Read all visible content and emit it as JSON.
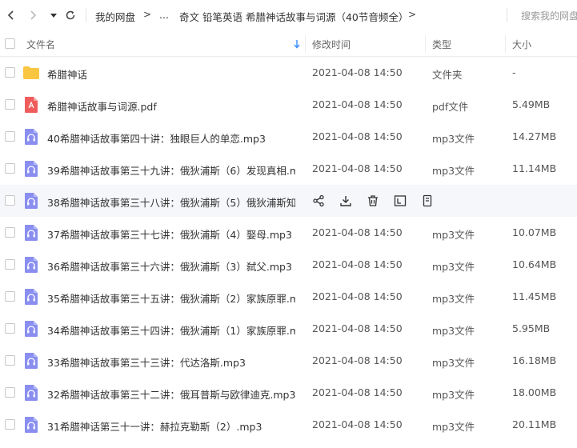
{
  "toolbar": {
    "breadcrumb": [
      "我的网盘",
      "...",
      "奇文 铅笔英语 希腊神话故事与词源（40节音频全）"
    ],
    "separator": ">",
    "search_placeholder": "搜索我的网盘"
  },
  "columns": {
    "name": "文件名",
    "modified": "修改时间",
    "type": "类型",
    "size": "大小"
  },
  "files": [
    {
      "name": "希腊神话",
      "date": "2021-04-08 14:50",
      "type": "文件夹",
      "size": "-",
      "icon": "folder-icon"
    },
    {
      "name": "希腊神话故事与词源.pdf",
      "date": "2021-04-08 14:50",
      "type": "pdf文件",
      "size": "5.49MB",
      "icon": "pdf-file-icon"
    },
    {
      "name": "40希腊神话故事第四十讲：独眼巨人的单恋.mp3",
      "date": "2021-04-08 14:50",
      "type": "mp3文件",
      "size": "14.27MB",
      "icon": "audio-file-icon"
    },
    {
      "name": "39希腊神话故事第三十九讲：俄狄浦斯（6）发现真相.m...",
      "date": "2021-04-08 14:50",
      "type": "mp3文件",
      "size": "11.14MB",
      "icon": "audio-file-icon"
    },
    {
      "name": "38希腊神话故事第三十八讲：俄狄浦斯（5）俄狄浦斯知...",
      "date": "",
      "type": "",
      "size": "",
      "icon": "audio-file-icon"
    },
    {
      "name": "37希腊神话故事第三十七讲：俄狄浦斯（4）娶母.mp3",
      "date": "2021-04-08 14:50",
      "type": "mp3文件",
      "size": "10.07MB",
      "icon": "audio-file-icon"
    },
    {
      "name": "36希腊神话故事第三十六讲：俄狄浦斯（3）弑父.mp3",
      "date": "2021-04-08 14:50",
      "type": "mp3文件",
      "size": "10.64MB",
      "icon": "audio-file-icon"
    },
    {
      "name": "35希腊神话故事第三十五讲：俄狄浦斯（2）家族原罪.m...",
      "date": "2021-04-08 14:50",
      "type": "mp3文件",
      "size": "11.45MB",
      "icon": "audio-file-icon"
    },
    {
      "name": "34希腊神话故事第三十四讲：俄狄浦斯（1）家族原罪.m...",
      "date": "2021-04-08 14:50",
      "type": "mp3文件",
      "size": "5.95MB",
      "icon": "audio-file-icon"
    },
    {
      "name": "33希腊神话故事第三十三讲：代达洛斯.mp3",
      "date": "2021-04-08 14:50",
      "type": "mp3文件",
      "size": "16.18MB",
      "icon": "audio-file-icon"
    },
    {
      "name": "32希腊神话故事第三十二讲：俄耳普斯与欧律迪克.mp3",
      "date": "2021-04-08 14:50",
      "type": "mp3文件",
      "size": "18.00MB",
      "icon": "audio-file-icon"
    },
    {
      "name": "31希腊神话第三十一讲：赫拉克勒斯（2）.mp3",
      "date": "2021-04-08 14:50",
      "type": "mp3文件",
      "size": "20.11MB",
      "icon": "audio-file-icon"
    }
  ],
  "hover_row_index": 4,
  "hover_actions": [
    "share-icon",
    "download-icon",
    "delete-icon",
    "rename-icon",
    "more-icon"
  ],
  "colors": {
    "folder": "#f9c642",
    "pdf": "#f05c5c",
    "audio": "#8a8ef0",
    "accent": "#3b8cff",
    "hover_row": "#f5f7fa"
  }
}
